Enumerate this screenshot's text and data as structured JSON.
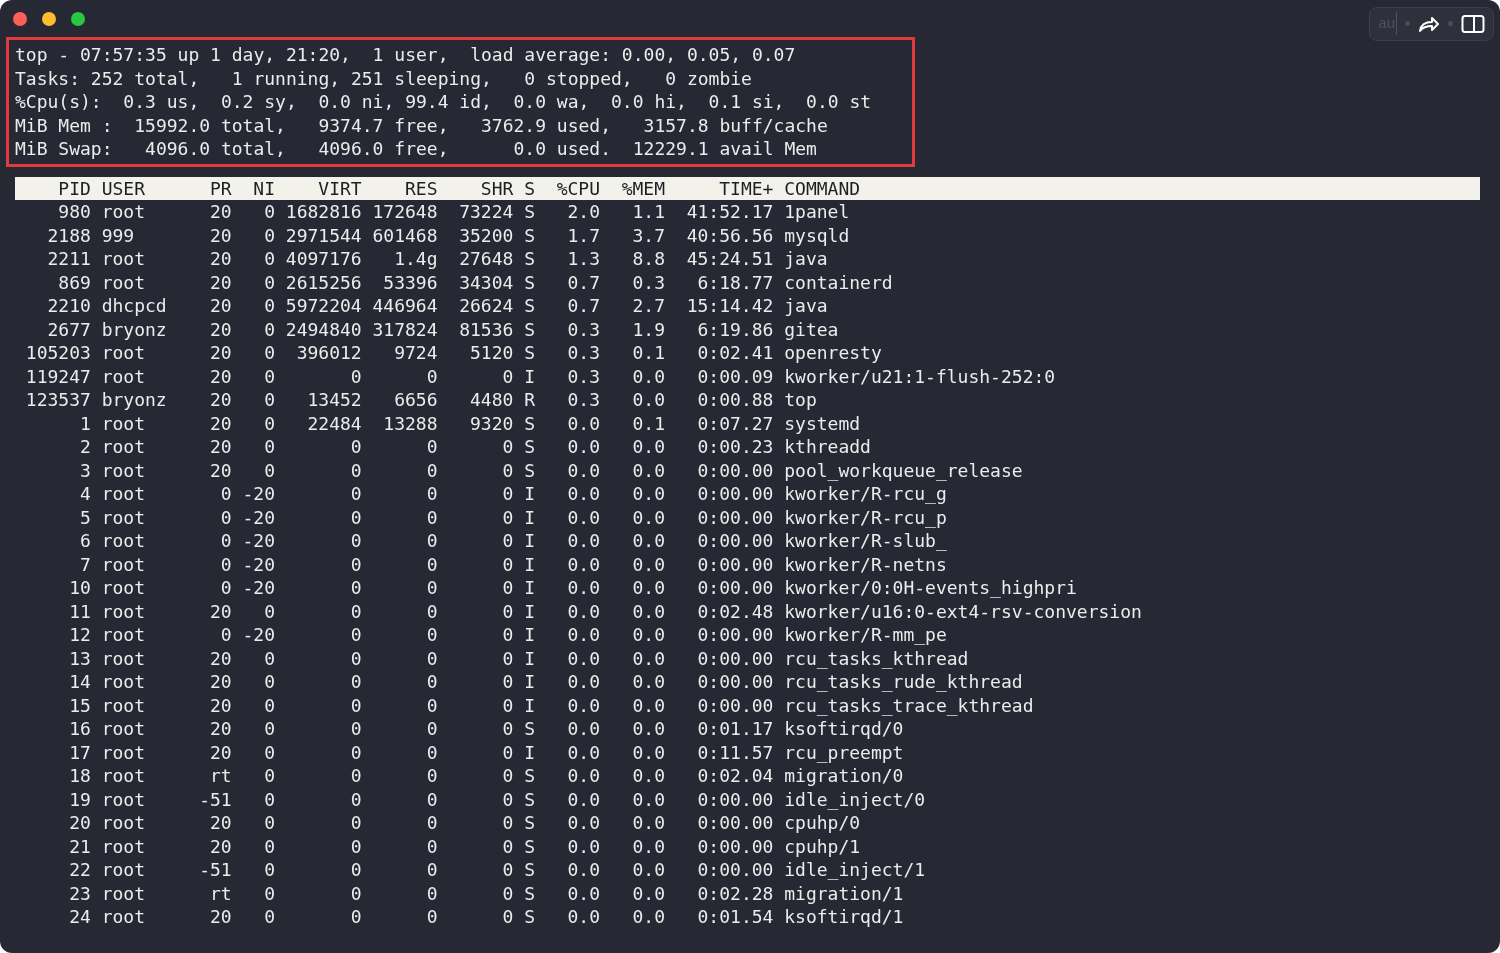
{
  "toolbar": {
    "input_text": "au"
  },
  "summary": [
    "top - 07:57:35 up 1 day, 21:20,  1 user,  load average: 0.00, 0.05, 0.07",
    "Tasks: 252 total,   1 running, 251 sleeping,   0 stopped,   0 zombie",
    "%Cpu(s):  0.3 us,  0.2 sy,  0.0 ni, 99.4 id,  0.0 wa,  0.0 hi,  0.1 si,  0.0 st",
    "MiB Mem :  15992.0 total,   9374.7 free,   3762.9 used,   3157.8 buff/cache",
    "MiB Swap:   4096.0 total,   4096.0 free,      0.0 used.  12229.1 avail Mem"
  ],
  "table": {
    "columns": [
      "PID",
      "USER",
      "PR",
      "NI",
      "VIRT",
      "RES",
      "SHR",
      "S",
      "%CPU",
      "%MEM",
      "TIME+",
      "COMMAND"
    ],
    "rows": [
      [
        "980",
        "root",
        "20",
        "0",
        "1682816",
        "172648",
        "73224",
        "S",
        "2.0",
        "1.1",
        "41:52.17",
        "1panel"
      ],
      [
        "2188",
        "999",
        "20",
        "0",
        "2971544",
        "601468",
        "35200",
        "S",
        "1.7",
        "3.7",
        "40:56.56",
        "mysqld"
      ],
      [
        "2211",
        "root",
        "20",
        "0",
        "4097176",
        "1.4g",
        "27648",
        "S",
        "1.3",
        "8.8",
        "45:24.51",
        "java"
      ],
      [
        "869",
        "root",
        "20",
        "0",
        "2615256",
        "53396",
        "34304",
        "S",
        "0.7",
        "0.3",
        "6:18.77",
        "containerd"
      ],
      [
        "2210",
        "dhcpcd",
        "20",
        "0",
        "5972204",
        "446964",
        "26624",
        "S",
        "0.7",
        "2.7",
        "15:14.42",
        "java"
      ],
      [
        "2677",
        "bryonz",
        "20",
        "0",
        "2494840",
        "317824",
        "81536",
        "S",
        "0.3",
        "1.9",
        "6:19.86",
        "gitea"
      ],
      [
        "105203",
        "root",
        "20",
        "0",
        "396012",
        "9724",
        "5120",
        "S",
        "0.3",
        "0.1",
        "0:02.41",
        "openresty"
      ],
      [
        "119247",
        "root",
        "20",
        "0",
        "0",
        "0",
        "0",
        "I",
        "0.3",
        "0.0",
        "0:00.09",
        "kworker/u21:1-flush-252:0"
      ],
      [
        "123537",
        "bryonz",
        "20",
        "0",
        "13452",
        "6656",
        "4480",
        "R",
        "0.3",
        "0.0",
        "0:00.88",
        "top"
      ],
      [
        "1",
        "root",
        "20",
        "0",
        "22484",
        "13288",
        "9320",
        "S",
        "0.0",
        "0.1",
        "0:07.27",
        "systemd"
      ],
      [
        "2",
        "root",
        "20",
        "0",
        "0",
        "0",
        "0",
        "S",
        "0.0",
        "0.0",
        "0:00.23",
        "kthreadd"
      ],
      [
        "3",
        "root",
        "20",
        "0",
        "0",
        "0",
        "0",
        "S",
        "0.0",
        "0.0",
        "0:00.00",
        "pool_workqueue_release"
      ],
      [
        "4",
        "root",
        "0",
        "-20",
        "0",
        "0",
        "0",
        "I",
        "0.0",
        "0.0",
        "0:00.00",
        "kworker/R-rcu_g"
      ],
      [
        "5",
        "root",
        "0",
        "-20",
        "0",
        "0",
        "0",
        "I",
        "0.0",
        "0.0",
        "0:00.00",
        "kworker/R-rcu_p"
      ],
      [
        "6",
        "root",
        "0",
        "-20",
        "0",
        "0",
        "0",
        "I",
        "0.0",
        "0.0",
        "0:00.00",
        "kworker/R-slub_"
      ],
      [
        "7",
        "root",
        "0",
        "-20",
        "0",
        "0",
        "0",
        "I",
        "0.0",
        "0.0",
        "0:00.00",
        "kworker/R-netns"
      ],
      [
        "10",
        "root",
        "0",
        "-20",
        "0",
        "0",
        "0",
        "I",
        "0.0",
        "0.0",
        "0:00.00",
        "kworker/0:0H-events_highpri"
      ],
      [
        "11",
        "root",
        "20",
        "0",
        "0",
        "0",
        "0",
        "I",
        "0.0",
        "0.0",
        "0:02.48",
        "kworker/u16:0-ext4-rsv-conversion"
      ],
      [
        "12",
        "root",
        "0",
        "-20",
        "0",
        "0",
        "0",
        "I",
        "0.0",
        "0.0",
        "0:00.00",
        "kworker/R-mm_pe"
      ],
      [
        "13",
        "root",
        "20",
        "0",
        "0",
        "0",
        "0",
        "I",
        "0.0",
        "0.0",
        "0:00.00",
        "rcu_tasks_kthread"
      ],
      [
        "14",
        "root",
        "20",
        "0",
        "0",
        "0",
        "0",
        "I",
        "0.0",
        "0.0",
        "0:00.00",
        "rcu_tasks_rude_kthread"
      ],
      [
        "15",
        "root",
        "20",
        "0",
        "0",
        "0",
        "0",
        "I",
        "0.0",
        "0.0",
        "0:00.00",
        "rcu_tasks_trace_kthread"
      ],
      [
        "16",
        "root",
        "20",
        "0",
        "0",
        "0",
        "0",
        "S",
        "0.0",
        "0.0",
        "0:01.17",
        "ksoftirqd/0"
      ],
      [
        "17",
        "root",
        "20",
        "0",
        "0",
        "0",
        "0",
        "I",
        "0.0",
        "0.0",
        "0:11.57",
        "rcu_preempt"
      ],
      [
        "18",
        "root",
        "rt",
        "0",
        "0",
        "0",
        "0",
        "S",
        "0.0",
        "0.0",
        "0:02.04",
        "migration/0"
      ],
      [
        "19",
        "root",
        "-51",
        "0",
        "0",
        "0",
        "0",
        "S",
        "0.0",
        "0.0",
        "0:00.00",
        "idle_inject/0"
      ],
      [
        "20",
        "root",
        "20",
        "0",
        "0",
        "0",
        "0",
        "S",
        "0.0",
        "0.0",
        "0:00.00",
        "cpuhp/0"
      ],
      [
        "21",
        "root",
        "20",
        "0",
        "0",
        "0",
        "0",
        "S",
        "0.0",
        "0.0",
        "0:00.00",
        "cpuhp/1"
      ],
      [
        "22",
        "root",
        "-51",
        "0",
        "0",
        "0",
        "0",
        "S",
        "0.0",
        "0.0",
        "0:00.00",
        "idle_inject/1"
      ],
      [
        "23",
        "root",
        "rt",
        "0",
        "0",
        "0",
        "0",
        "S",
        "0.0",
        "0.0",
        "0:02.28",
        "migration/1"
      ],
      [
        "24",
        "root",
        "20",
        "0",
        "0",
        "0",
        "0",
        "S",
        "0.0",
        "0.0",
        "0:01.54",
        "ksoftirqd/1"
      ]
    ]
  }
}
